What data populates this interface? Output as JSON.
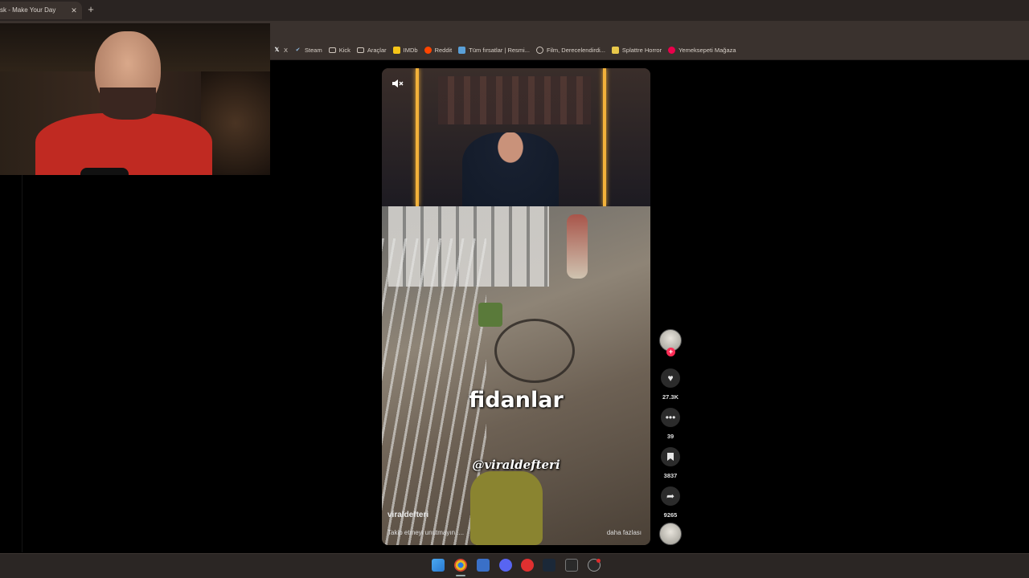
{
  "browser": {
    "tab_title": "sk - Make Your Day",
    "tab_close": "✕",
    "new_tab": "+"
  },
  "bookmarks": [
    {
      "label": "X",
      "icon": "x-icon"
    },
    {
      "label": "Steam",
      "icon": "steam-icon"
    },
    {
      "label": "Kick",
      "icon": "folder-icon"
    },
    {
      "label": "Araçlar",
      "icon": "folder-icon"
    },
    {
      "label": "IMDb",
      "icon": "imdb-icon"
    },
    {
      "label": "Reddit",
      "icon": "reddit-icon"
    },
    {
      "label": "Tüm fırsatlar | Resmi...",
      "icon": "page-icon"
    },
    {
      "label": "Film, Derecelendirdi...",
      "icon": "globe-icon"
    },
    {
      "label": "Splattre Horror",
      "icon": "splattre-icon"
    },
    {
      "label": "Yemeksepeti Mağaza",
      "icon": "yemeksepeti-icon"
    }
  ],
  "video": {
    "mute_icon": "🔇",
    "caption": "fidanlar",
    "watermark": "@viraldefteri",
    "author": "viraldefteri",
    "description": "Takip etmeyi unutmayın.....",
    "more": "daha fazlası"
  },
  "actions": {
    "follow_plus": "+",
    "like_count": "27.3K",
    "comment_count": "39",
    "save_count": "3837",
    "share_count": "9265"
  },
  "colors": {
    "accent_pink": "#fe2c55",
    "neon": "#f2b13a"
  }
}
